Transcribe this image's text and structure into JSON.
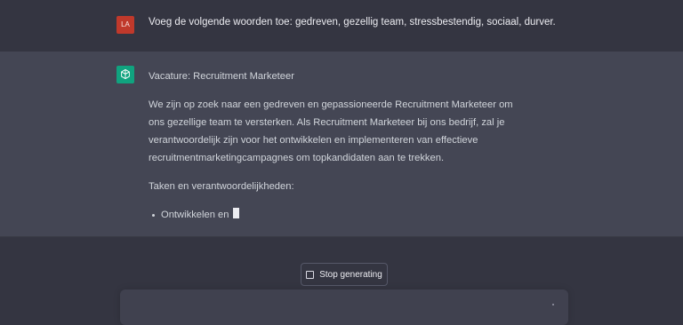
{
  "user_message": {
    "avatar_initials": "LA",
    "text": "Voeg de volgende woorden toe: gedreven, gezellig team, stressbestendig, sociaal, durver."
  },
  "assistant_message": {
    "icon": "openai-logo-icon",
    "title": "Vacature: Recruitment Marketeer",
    "paragraph": "We zijn op zoek naar een gedreven en gepassioneerde Recruitment Marketeer om ons gezellige team te versterken. Als Recruitment Marketeer bij ons bedrijf, zal je verantwoordelijk zijn voor het ontwikkelen en implementeren van effectieve recruitmentmarketingcampagnes om topkandidaten aan te trekken.",
    "section_heading": "Taken en verantwoordelijkheden:",
    "bullets": [
      "Ontwikkelen en"
    ]
  },
  "controls": {
    "stop_label": "Stop generating"
  },
  "colors": {
    "background": "#343541",
    "assistant_background": "#444654",
    "user_avatar": "#c0392b",
    "bot_avatar": "#10a37f"
  }
}
